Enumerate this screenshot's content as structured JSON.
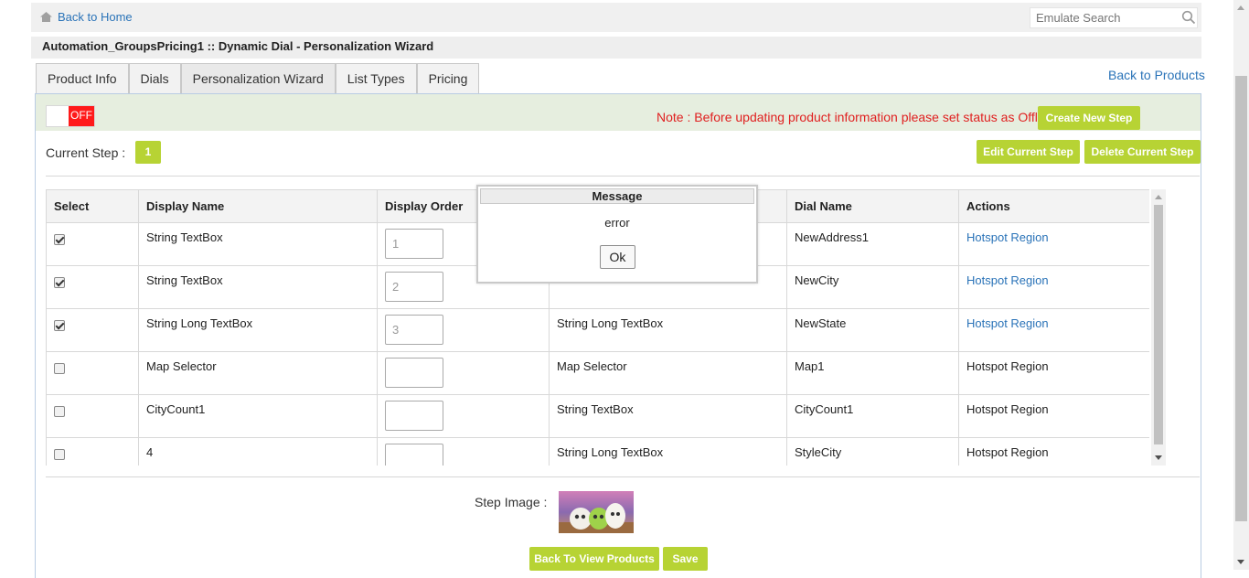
{
  "header": {
    "home_link": "Back to Home",
    "search_placeholder": "Emulate Search"
  },
  "page_title": "Automation_GroupsPricing1 :: Dynamic Dial - Personalization Wizard",
  "tabs": [
    {
      "label": "Product Info",
      "active": false
    },
    {
      "label": "Dials",
      "active": false
    },
    {
      "label": "Personalization Wizard",
      "active": true
    },
    {
      "label": "List Types",
      "active": false
    },
    {
      "label": "Pricing",
      "active": false
    }
  ],
  "back_to_products": "Back to Products",
  "status": {
    "toggle_label": "OFF",
    "note": "Note : Before updating product information please set status as Offline",
    "create_new_step": "Create New Step"
  },
  "step": {
    "label": "Current Step :",
    "number": "1",
    "edit_button": "Edit Current Step",
    "delete_button": "Delete Current Step"
  },
  "grid": {
    "headers": {
      "select": "Select",
      "display_name": "Display Name",
      "display_order": "Display Order",
      "control_type": "",
      "dial_name": "Dial Name",
      "actions": "Actions"
    },
    "rows": [
      {
        "checked": true,
        "display_name": "String TextBox",
        "order": "1",
        "control": "",
        "dial": "NewAddress1",
        "action": "Hotspot Region",
        "action_link": true
      },
      {
        "checked": true,
        "display_name": "String TextBox",
        "order": "2",
        "control": "",
        "dial": "NewCity",
        "action": "Hotspot Region",
        "action_link": true
      },
      {
        "checked": true,
        "display_name": "String Long TextBox",
        "order": "3",
        "control": "String Long TextBox",
        "dial": "NewState",
        "action": "Hotspot Region",
        "action_link": true
      },
      {
        "checked": false,
        "display_name": "Map Selector",
        "order": "",
        "control": "Map Selector",
        "dial": "Map1",
        "action": "Hotspot Region",
        "action_link": false
      },
      {
        "checked": false,
        "display_name": "CityCount1",
        "order": "",
        "control": "String TextBox",
        "dial": "CityCount1",
        "action": "Hotspot Region",
        "action_link": false
      },
      {
        "checked": false,
        "display_name": "4",
        "order": "",
        "control": "String Long TextBox",
        "dial": "StyleCity",
        "action": "Hotspot Region",
        "action_link": false
      }
    ]
  },
  "step_image_label": "Step Image :",
  "footer": {
    "back_button": "Back To View Products",
    "save_button": "Save"
  },
  "modal": {
    "title": "Message",
    "message": "error",
    "ok_label": "Ok"
  },
  "colors": {
    "accent_green": "#b7d334",
    "link_blue": "#2a73b8",
    "alert_red": "#e02020",
    "toggle_off_red": "#ff1a1a",
    "status_band": "#e6eedf"
  }
}
